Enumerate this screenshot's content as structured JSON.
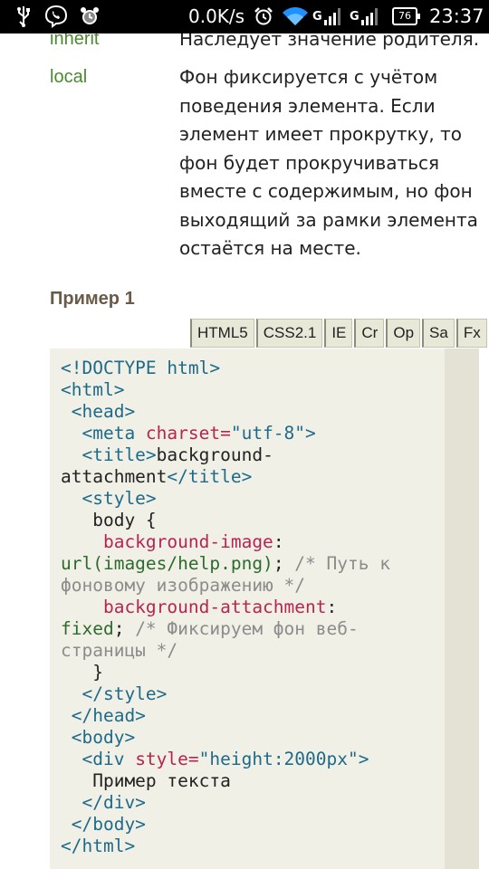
{
  "status_bar": {
    "speed": "0.0K/s",
    "signal1_label": "G",
    "signal2_label": "G",
    "battery": "76",
    "time": "23:37",
    "icons": [
      "usb-icon",
      "viber-icon",
      "alarm-clock-icon",
      "alarm-icon",
      "wifi-icon",
      "signal-icon",
      "signal-icon",
      "battery-icon"
    ]
  },
  "properties": [
    {
      "term": "inherit",
      "desc": "Наследует значение родителя."
    },
    {
      "term": "local",
      "desc": "Фон фиксируется с учётом поведения элемента. Если элемент имеет прокрутку, то фон будет прокручиваться вместе с содержимым, но фон выходящий за рамки элемента остаётся на месте."
    }
  ],
  "example": {
    "title": "Пример 1",
    "browsers": [
      "HTML5",
      "CSS2.1",
      "IE",
      "Cr",
      "Op",
      "Sa",
      "Fx"
    ]
  },
  "code": {
    "l01_tag": "<!DOCTYPE html>",
    "l02_tag": "<html>",
    "l03_tag": " <head>",
    "l04_open": "  <meta ",
    "l04_attr": "charset=",
    "l04_str": "\"utf-8\"",
    "l04_close": ">",
    "l05_open": "  <title>",
    "l05_text": "background-",
    "l06_text": "attachment",
    "l06_close": "</title>",
    "l07_tag": "  <style>",
    "l08_text": "   body {",
    "l09_prop": "    background-image",
    "l09_colon": ":",
    "l10_fn": "url(images/help.png)",
    "l10_semi": "; ",
    "l10_cmt": "/* Путь к",
    "l11_cmt": "фоновому изображению */",
    "l12_prop": "    background-attachment",
    "l12_colon": ":",
    "l13_fn": "fixed",
    "l13_semi": "; ",
    "l13_cmt": "/* Фиксируем фон веб-",
    "l14_cmt": "страницы */",
    "l15_text": "   }",
    "l16_tag": "  </style>",
    "l17_tag": " </head>",
    "l18_tag": " <body>",
    "l19_open": "  <div ",
    "l19_attr": "style=",
    "l19_str": "\"height:2000px\"",
    "l19_close": ">",
    "l20_text": "   Пример текста",
    "l21_tag": "  </div>",
    "l22_tag": " </body>",
    "l23_tag": "</html>"
  },
  "colors": {
    "term": "#4a8a2f",
    "example_title": "#6b5a48",
    "code_bg": "#f1f0e6",
    "tag": "#1d6a8a",
    "attr": "#b5254f",
    "comment": "#8c8c8c",
    "function": "#2d6b2d"
  }
}
